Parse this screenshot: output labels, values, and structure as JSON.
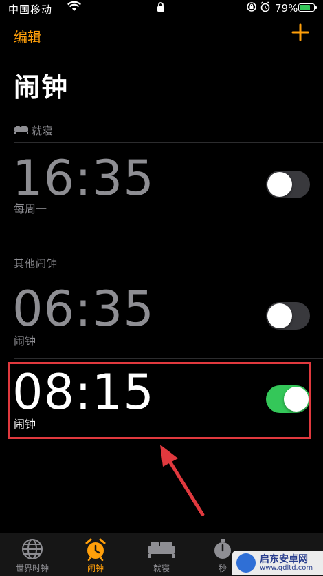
{
  "status_bar": {
    "carrier": "中国移动",
    "battery_percent": "79%",
    "battery_level": 0.79
  },
  "nav": {
    "edit_label": "编辑",
    "title": "闹钟"
  },
  "sections": {
    "sleep_label": "就寝",
    "other_label": "其他闹钟"
  },
  "alarms": [
    {
      "time": "16:35",
      "label": "每周一",
      "enabled": false
    },
    {
      "time": "06:35",
      "label": "闹钟",
      "enabled": false
    },
    {
      "time": "08:15",
      "label": "闹钟",
      "enabled": true
    }
  ],
  "tabs": [
    {
      "label": "世界时钟",
      "icon": "globe-icon",
      "active": false
    },
    {
      "label": "闹钟",
      "icon": "alarm-clock-icon",
      "active": true
    },
    {
      "label": "就寝",
      "icon": "bed-icon",
      "active": false
    },
    {
      "label": "秒",
      "icon": "stopwatch-icon",
      "active": false
    }
  ],
  "watermark": {
    "name": "启东安卓网",
    "url": "www.qdltd.com"
  },
  "colors": {
    "accent": "#ff9f0a",
    "toggle_on": "#34c759",
    "highlight": "#e0393e"
  }
}
